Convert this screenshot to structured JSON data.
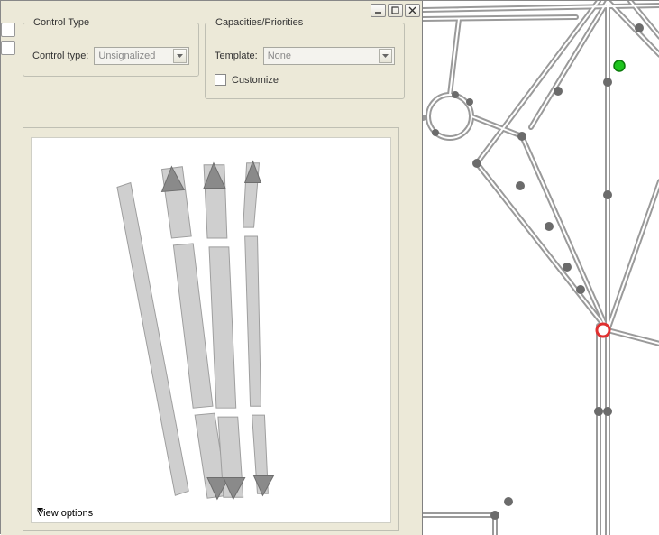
{
  "titlebar": {
    "minimize_icon": "minimize",
    "maximize_icon": "maximize",
    "close_icon": "close"
  },
  "groups": {
    "control_type": {
      "title": "Control Type",
      "label": "Control type:",
      "value": "Unsignalized"
    },
    "capacities": {
      "title": "Capacities/Priorities",
      "template_label": "Template:",
      "template_value": "None",
      "customize_label": "Customize"
    }
  },
  "preview": {
    "view_options_label": "View options"
  }
}
